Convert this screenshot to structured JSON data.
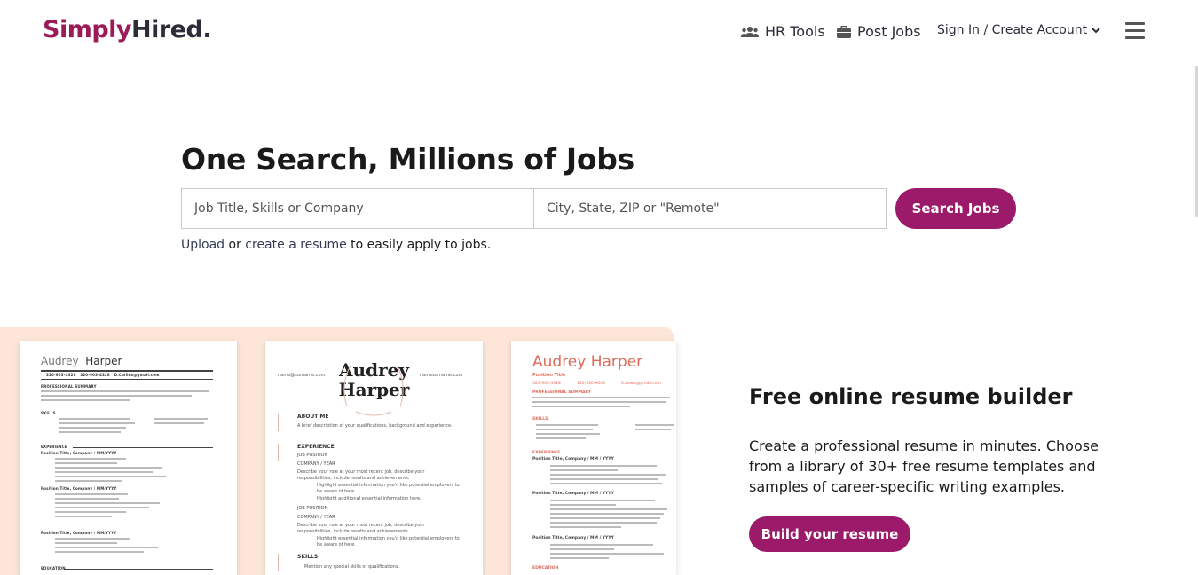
{
  "header": {
    "logo_simply": "Simply",
    "logo_hired": "Hired",
    "logo_dot": ".",
    "hr_tools": "HR Tools",
    "post_jobs": "Post Jobs",
    "sign_in": "Sign In / Create Account",
    "icons": {
      "hr_tools": "users-icon",
      "post_jobs": "briefcase-icon",
      "account": "chevron-down-icon",
      "menu": "hamburger-menu-icon"
    }
  },
  "hero": {
    "title": "One Search, Millions of Jobs",
    "what_placeholder": "Job Title, Skills or Company",
    "where_placeholder": "City, State, ZIP or \"Remote\"",
    "search_button": "Search Jobs",
    "upload_link": "Upload",
    "or_text": " or ",
    "create_link": "create a resume",
    "tail_text": " to easily apply to jobs."
  },
  "resume_section": {
    "title": "Free online resume builder",
    "text": "Create a professional resume in minutes. Choose from a library of 30+ free resume templates and samples of career-specific writing examples.",
    "button": "Build your resume"
  },
  "resume_samples": {
    "card1": {
      "name_first": "Audrey",
      "name_last": "Harper",
      "phone1": "320-903-4328",
      "phone2": "320-903-4328",
      "email": "D.Collins@gmail.com",
      "sec_summary": "PROFESSIONAL SUMMARY",
      "sec_skills": "SKILLS",
      "sec_experience": "EXPERIENCE",
      "position": "Position Title, Company / MM/YYYY",
      "sec_education": "EDUCATION"
    },
    "card2": {
      "name_line1": "Audrey",
      "name_line2": "Harper",
      "email": "name@surname.com",
      "web": "namesurname.com",
      "about_me": "ABOUT ME",
      "about_text": "A brief description of your qualifications, background and experience.",
      "experience": "EXPERIENCE",
      "job_position": "JOB POSITION",
      "company_year": "COMPANY / YEAR",
      "role_text": "Describe your role at your most recent job, describe your responsibilities, include results and achievements.",
      "bullet1": "Highlight essential information you'd like potential employers to be aware of here.",
      "bullet2": "Highlight additional essential information here.",
      "skills": "SKILLS",
      "skills_bullet": "Mention any special skills or qualifications."
    },
    "card3": {
      "name": "Audrey Harper",
      "position": "Position Title",
      "phone1": "320-903-4328",
      "phone2": "320-430-9643",
      "email": "K.Lewis@gmail.com",
      "sec_summary": "PROFESSIONAL SUMMARY",
      "sec_skills": "SKILLS",
      "sec_experience": "EXPERIENCE",
      "position_line": "Position Title, Company / MM / YYYY",
      "sec_education": "EDUCATION"
    }
  },
  "colors": {
    "brand": "#9b1b6a",
    "logo_simply": "#9b1b58",
    "resume_bg": "#fde6d8",
    "card3_accent": "#e06a5a"
  }
}
